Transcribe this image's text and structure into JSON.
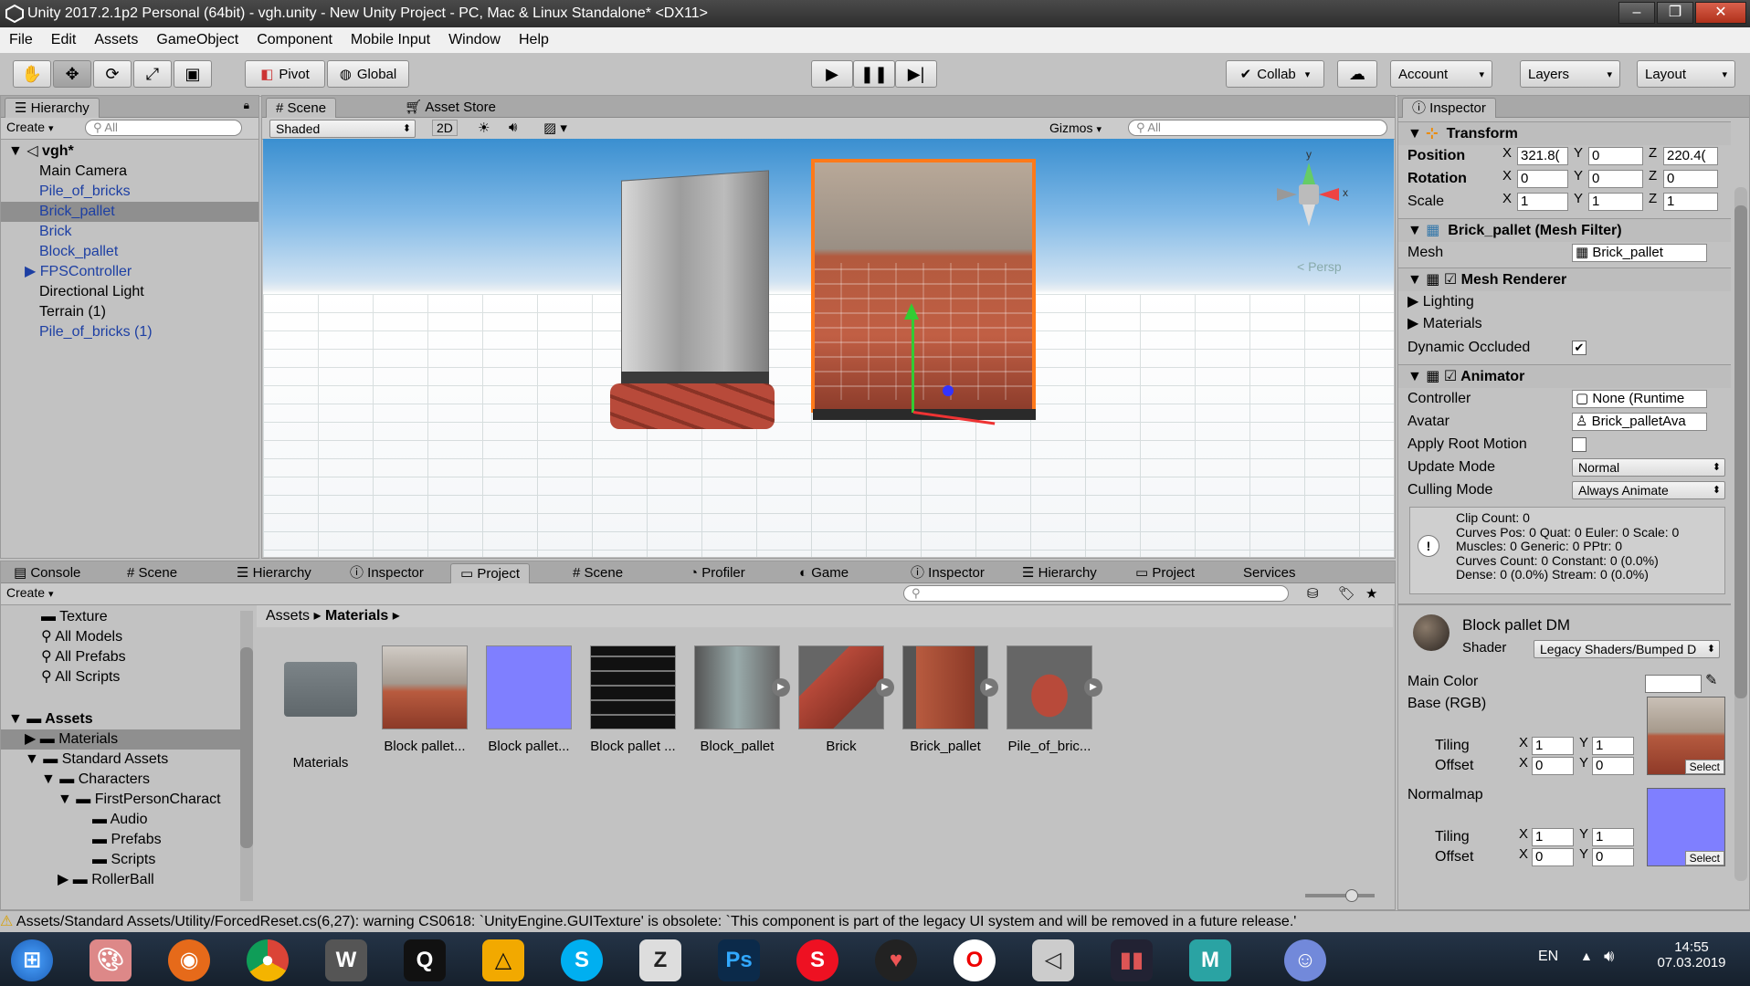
{
  "window": {
    "title": "Unity 2017.2.1p2 Personal (64bit) - vgh.unity - New Unity Project - PC, Mac & Linux Standalone* <DX11>"
  },
  "menu": [
    "File",
    "Edit",
    "Assets",
    "GameObject",
    "Component",
    "Mobile Input",
    "Window",
    "Help"
  ],
  "toolbar": {
    "pivot": "Pivot",
    "global": "Global",
    "collab": "Collab",
    "account": "Account",
    "layers": "Layers",
    "layout": "Layout"
  },
  "hierarchy": {
    "tab": "Hierarchy",
    "create": "Create",
    "search_placeholder": "All",
    "scene": "vgh*",
    "items": [
      "Main Camera",
      "Pile_of_bricks",
      "Brick_pallet",
      "Brick",
      "Block_pallet",
      "FPSController",
      "Directional Light",
      "Terrain (1)",
      "Pile_of_bricks (1)"
    ]
  },
  "scene": {
    "tab_scene": "Scene",
    "tab_store": "Asset Store",
    "shading": "Shaded",
    "mode2d": "2D",
    "gizmos": "Gizmos",
    "search_placeholder": "All",
    "persp": "Persp",
    "gizmo_y": "y",
    "gizmo_x": "x"
  },
  "inspector": {
    "tab": "Inspector",
    "transform": {
      "title": "Transform",
      "position_label": "Position",
      "px": "321.8(",
      "py": "0",
      "pz": "220.4(",
      "rotation_label": "Rotation",
      "rx": "0",
      "ry": "0",
      "rz": "0",
      "scale_label": "Scale",
      "sx": "1",
      "sy": "1",
      "sz": "1",
      "x": "X",
      "y": "Y",
      "z": "Z"
    },
    "mesh_filter": {
      "title": "Brick_pallet (Mesh Filter)",
      "mesh_label": "Mesh",
      "mesh_value": "Brick_pallet"
    },
    "mesh_renderer": {
      "title": "Mesh Renderer",
      "lighting": "Lighting",
      "materials": "Materials",
      "dynamic_occluded": "Dynamic Occluded"
    },
    "animator": {
      "title": "Animator",
      "controller_label": "Controller",
      "controller_value": "None (Runtime",
      "avatar_label": "Avatar",
      "avatar_value": "Brick_palletAva",
      "root_motion_label": "Apply Root Motion",
      "update_mode_label": "Update Mode",
      "update_mode_value": "Normal",
      "culling_label": "Culling Mode",
      "culling_value": "Always Animate",
      "info": [
        "Clip Count: 0",
        "Curves Pos: 0 Quat: 0 Euler: 0 Scale: 0",
        "Muscles: 0 Generic: 0 PPtr: 0",
        "Curves Count: 0 Constant: 0 (0.0%)",
        "Dense: 0 (0.0%) Stream: 0 (0.0%)"
      ]
    },
    "material": {
      "name": "Block pallet DM",
      "shader_label": "Shader",
      "shader_value": "Legacy Shaders/Bumped D",
      "main_color": "Main Color",
      "base": "Base (RGB)",
      "tiling": "Tiling",
      "offset": "Offset",
      "t1x": "1",
      "t1y": "1",
      "o1x": "0",
      "o1y": "0",
      "normalmap": "Normalmap",
      "t2x": "1",
      "t2y": "1",
      "o2x": "0",
      "o2y": "0",
      "select": "Select"
    }
  },
  "bottom_tabs": [
    "Console",
    "Scene",
    "Hierarchy",
    "Inspector",
    "Project",
    "Scene",
    "Profiler",
    "Game",
    "Inspector",
    "Hierarchy",
    "Project",
    "Services"
  ],
  "project": {
    "create": "Create",
    "favorites": [
      "Texture",
      "All Models",
      "All Prefabs",
      "All Scripts"
    ],
    "tree": {
      "assets": "Assets",
      "materials": "Materials",
      "standard": "Standard Assets",
      "characters": "Characters",
      "fps": "FirstPersonCharact",
      "audio": "Audio",
      "prefabs": "Prefabs",
      "scripts": "Scripts",
      "rollerball": "RollerBall"
    },
    "breadcrumb": {
      "root": "Assets",
      "current": "Materials"
    },
    "assets": [
      "Materials",
      "Block pallet...",
      "Block pallet...",
      "Block pallet ...",
      "Block_pallet",
      "Brick",
      "Brick_pallet",
      "Pile_of_bric..."
    ]
  },
  "status": {
    "message": "Assets/Standard Assets/Utility/ForcedReset.cs(6,27): warning CS0618: `UnityEngine.GUITexture' is obsolete: `This component is part of the legacy UI system and will be removed in a future release.'"
  },
  "taskbar": {
    "lang": "EN",
    "time": "14:55",
    "date": "07.03.2019"
  },
  "colors": {
    "accent_blue": "#1d3fa3",
    "selection_orange": "#ff7a1a",
    "normalmap": "#7f7fff"
  }
}
